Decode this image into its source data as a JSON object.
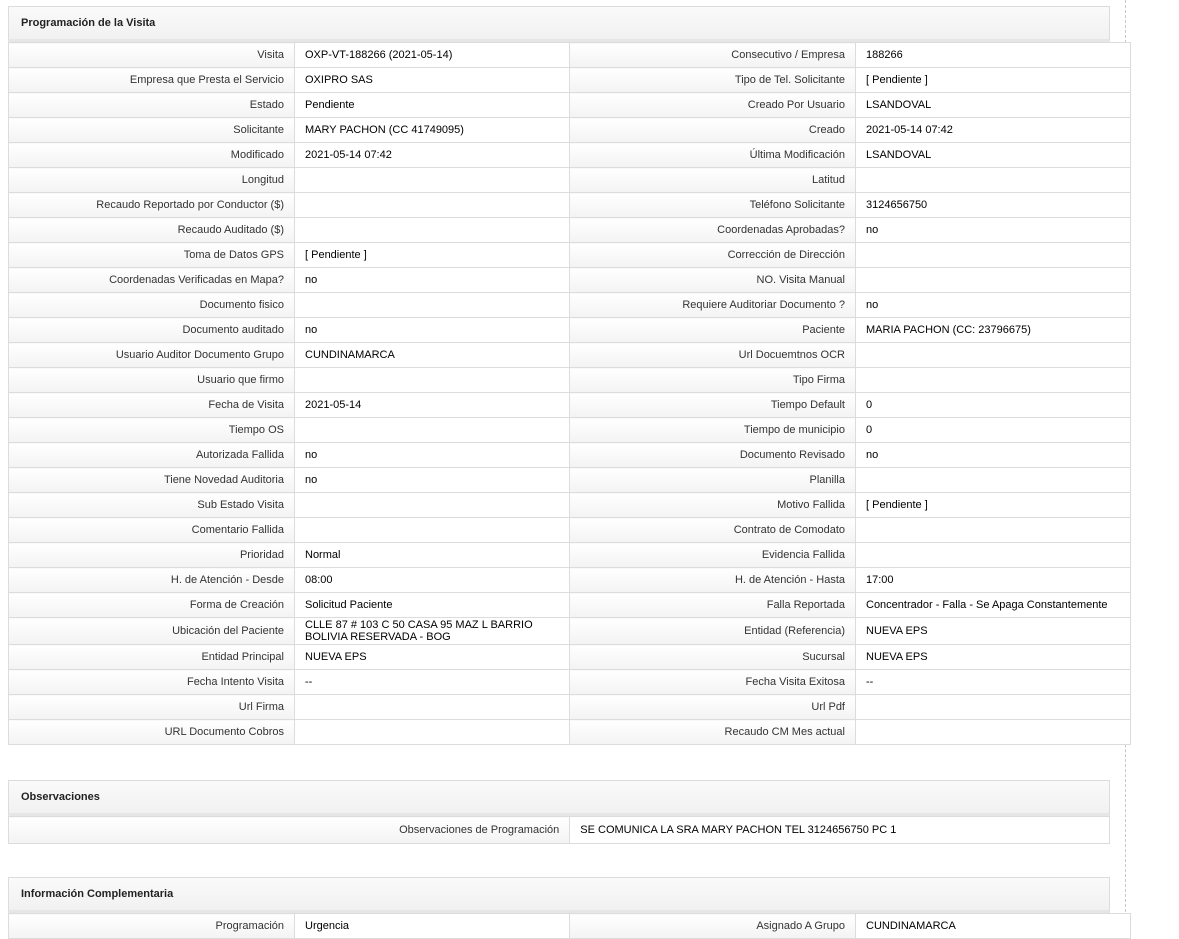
{
  "programacion": {
    "title": "Programación de la Visita",
    "rows": [
      [
        "Visita",
        "OXP-VT-188266 (2021-05-14)",
        "Consecutivo / Empresa",
        "188266"
      ],
      [
        "Empresa que Presta el Servicio",
        "OXIPRO SAS",
        "Tipo de Tel. Solicitante",
        "[ Pendiente ]"
      ],
      [
        "Estado",
        "Pendiente",
        "Creado Por Usuario",
        "LSANDOVAL"
      ],
      [
        "Solicitante",
        "MARY PACHON (CC 41749095)",
        "Creado",
        "2021-05-14 07:42"
      ],
      [
        "Modificado",
        "2021-05-14 07:42",
        "Última Modificación",
        " LSANDOVAL"
      ],
      [
        "Longitud",
        "",
        "Latitud",
        ""
      ],
      [
        "Recaudo Reportado por Conductor ($)",
        "",
        "Teléfono Solicitante",
        "3124656750"
      ],
      [
        "Recaudo Auditado ($)",
        "",
        "Coordenadas Aprobadas?",
        " no"
      ],
      [
        "Toma de Datos GPS",
        "[ Pendiente ]",
        "Corrección de Dirección",
        ""
      ],
      [
        "Coordenadas Verificadas en Mapa?",
        " no",
        "NO. Visita Manual",
        ""
      ],
      [
        "Documento fisico",
        "",
        "Requiere Auditoriar Documento ?",
        " no"
      ],
      [
        "Documento auditado",
        " no",
        "Paciente",
        "MARIA PACHON (CC: 23796675)"
      ],
      [
        "Usuario Auditor Documento Grupo",
        "CUNDINAMARCA",
        "Url Docuemtnos OCR",
        ""
      ],
      [
        "Usuario que firmo",
        "",
        "Tipo Firma",
        ""
      ],
      [
        "Fecha de Visita",
        " 2021-05-14",
        "Tiempo Default",
        " 0"
      ],
      [
        "Tiempo OS",
        "",
        "Tiempo de municipio",
        " 0"
      ],
      [
        "Autorizada Fallida",
        " no",
        "Documento Revisado",
        " no"
      ],
      [
        "Tiene Novedad Auditoria",
        " no",
        "Planilla",
        ""
      ],
      [
        "Sub Estado Visita",
        "",
        "Motivo Fallida",
        "[ Pendiente ]"
      ],
      [
        "Comentario Fallida",
        "",
        "Contrato de Comodato",
        ""
      ],
      [
        "Prioridad",
        "Normal",
        "Evidencia Fallida",
        ""
      ],
      [
        "H. de Atención - Desde",
        "08:00",
        "H. de Atención - Hasta",
        "17:00"
      ],
      [
        "Forma de Creación",
        "Solicitud Paciente",
        "Falla Reportada",
        "Concentrador - Falla - Se Apaga Constantemente"
      ],
      [
        "Ubicación del Paciente",
        "CLLE 87 # 103 C 50 CASA 95 MAZ L BARRIO BOLIVIA RESERVADA - BOG",
        "Entidad (Referencia)",
        "NUEVA EPS"
      ],
      [
        "Entidad Principal",
        "NUEVA EPS",
        "Sucursal",
        "NUEVA EPS"
      ],
      [
        "Fecha Intento Visita",
        " --",
        "Fecha Visita Exitosa",
        " --"
      ],
      [
        "Url Firma",
        "",
        "Url Pdf",
        ""
      ],
      [
        "URL Documento Cobros",
        "",
        "Recaudo CM Mes actual",
        ""
      ]
    ]
  },
  "observaciones": {
    "title": "Observaciones",
    "label": "Observaciones de Programación",
    "value": "SE COMUNICA LA SRA MARY PACHON TEL 3124656750 PC 1"
  },
  "complementaria": {
    "title": "Información Complementaria",
    "rows": [
      [
        "Programación",
        "Urgencia",
        "Asignado A Grupo",
        "CUNDINAMARCA"
      ]
    ]
  }
}
